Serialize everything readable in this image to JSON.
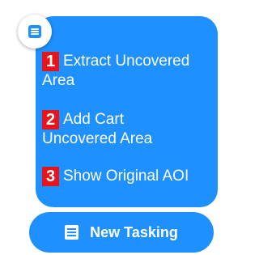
{
  "menu": {
    "toggle_icon": "menu-list-icon",
    "items": [
      {
        "number": "1",
        "label_line1": "Extract Uncovered",
        "label_line2": "Area"
      },
      {
        "number": "2",
        "label_line1": "Add Cart",
        "label_line2": "Uncovered Area"
      },
      {
        "number": "3",
        "label_line1": "Show Original AOI"
      }
    ]
  },
  "tasking_button": {
    "label": "New Tasking",
    "icon": "list-icon"
  },
  "colors": {
    "accent": "#1e90ff",
    "badge": "#e8141b",
    "text": "#ffffff"
  }
}
